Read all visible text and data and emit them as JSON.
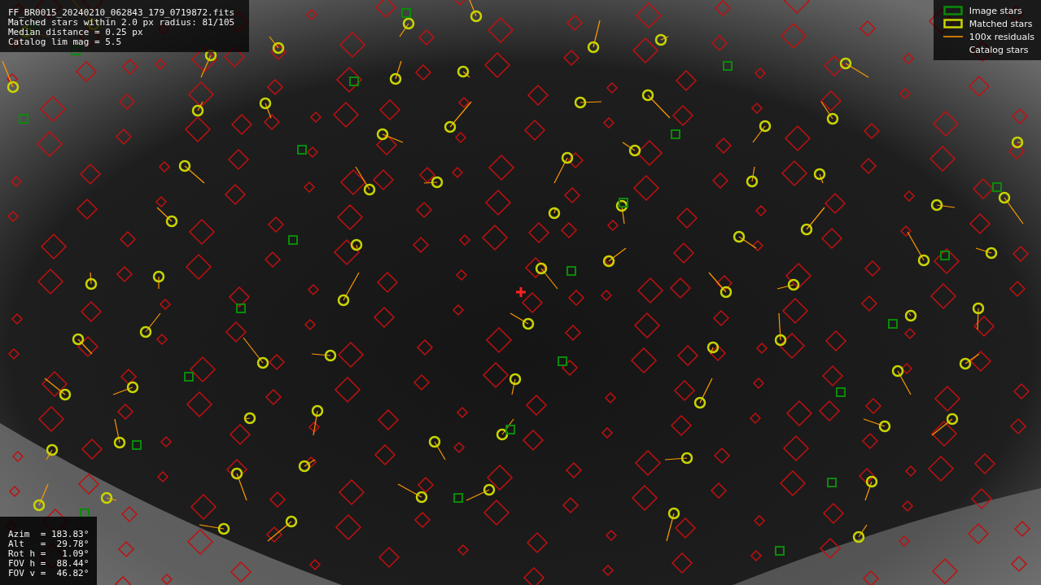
{
  "info_lines": [
    "FF_BR0015_20240210_062843_179_0719872.fits",
    "Matched stars within 2.0 px radius: 81/105",
    "Median distance = 0.25 px",
    "Catalog lim mag = 5.5"
  ],
  "legend": [
    {
      "kind": "image",
      "label": "Image stars"
    },
    {
      "kind": "matched",
      "label": "Matched stars"
    },
    {
      "kind": "residual",
      "label": "100x residuals"
    },
    {
      "kind": "catalog",
      "label": "Catalog stars"
    }
  ],
  "pointing": [
    "Azim  = 183.83°",
    "Alt   =  29.78°",
    "Rot h =   1.09°",
    "FOV h =  88.44°",
    "FOV v =  46.82°"
  ]
}
